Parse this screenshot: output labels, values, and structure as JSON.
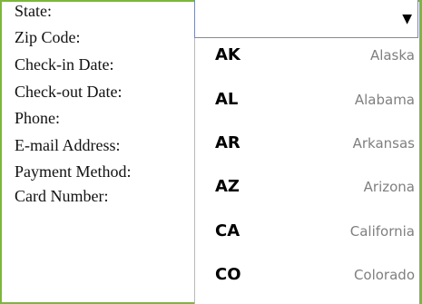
{
  "form": {
    "labels": [
      "State:",
      "Zip Code:",
      "Check-in Date:",
      "Check-out Date:",
      "Phone:",
      "E-mail Address:",
      "Payment Method:",
      "Card Number:"
    ]
  },
  "state_select": {
    "value": "",
    "arrow_icon": "dropdown-arrow-icon",
    "arrow_glyph": "▼",
    "options": [
      {
        "code": "AK",
        "name": "Alaska"
      },
      {
        "code": "AL",
        "name": "Alabama"
      },
      {
        "code": "AR",
        "name": "Arkansas"
      },
      {
        "code": "AZ",
        "name": "Arizona"
      },
      {
        "code": "CA",
        "name": "California"
      },
      {
        "code": "CO",
        "name": "Colorado"
      }
    ]
  },
  "colors": {
    "frame_border": "#7db540",
    "select_border": "#7a8bb0",
    "option_name": "#7f7f7f"
  }
}
